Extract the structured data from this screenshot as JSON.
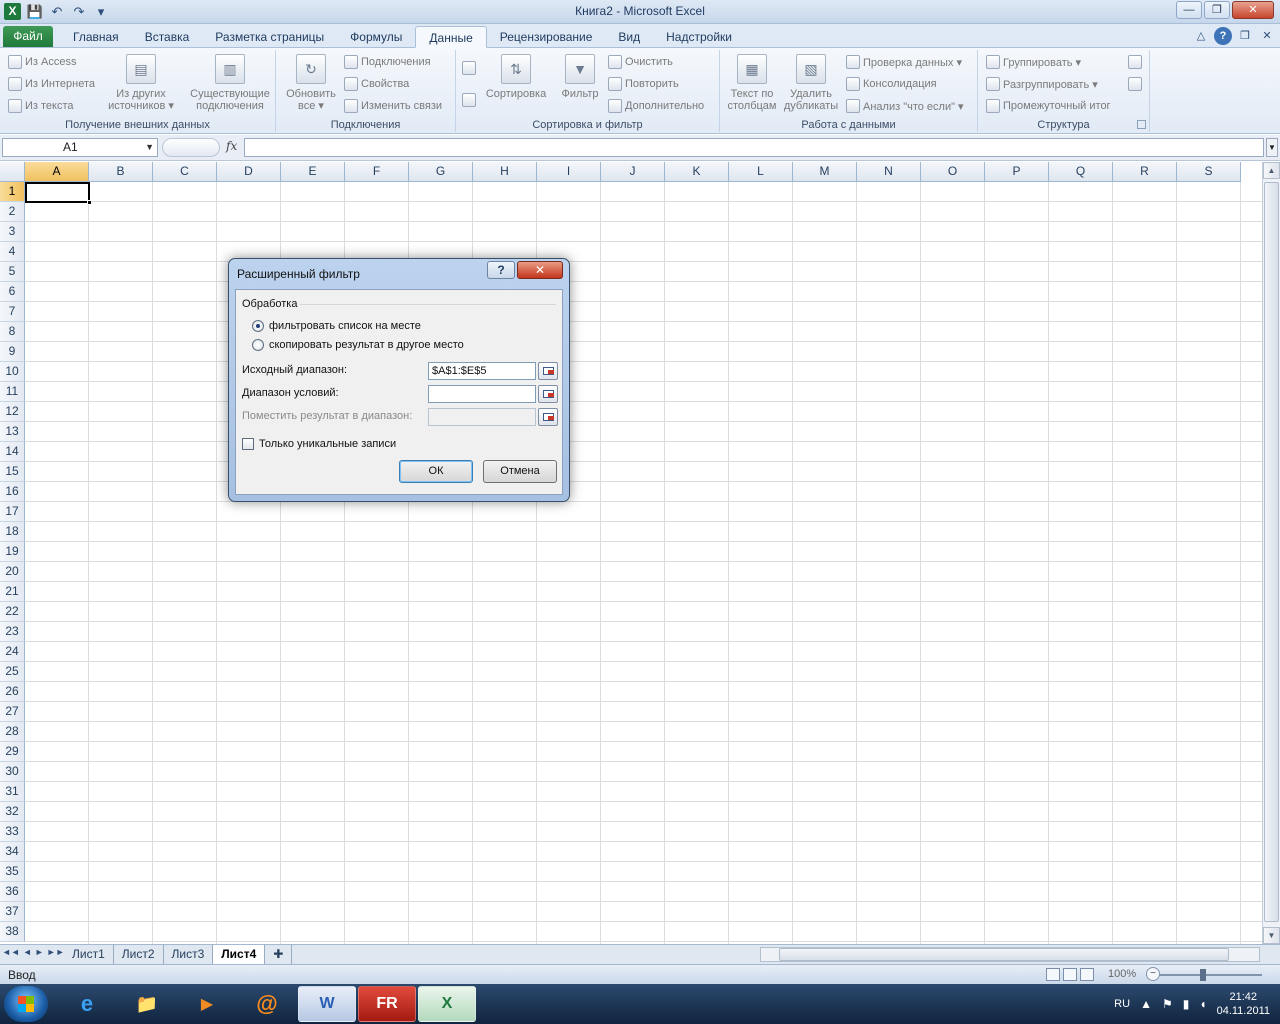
{
  "window": {
    "title": "Книга2  -  Microsoft Excel",
    "app_icon": "X"
  },
  "qat": {
    "save": "💾",
    "undo": "↶",
    "redo": "↷",
    "customize": "▾"
  },
  "win_controls": {
    "minimize": "—",
    "restore": "❐",
    "close": "✕"
  },
  "ribbon_tabs": {
    "file": "Файл",
    "items": [
      "Главная",
      "Вставка",
      "Разметка страницы",
      "Формулы",
      "Данные",
      "Рецензирование",
      "Вид",
      "Надстройки"
    ],
    "active_index": 4
  },
  "ribbon_right": {
    "minimize": "△",
    "help": "?",
    "restore": "❐",
    "close": "✕"
  },
  "ribbon": {
    "external": {
      "label": "Получение внешних данных",
      "from_access": "Из Access",
      "from_web": "Из Интернета",
      "from_text": "Из текста",
      "other_line1": "Из других",
      "other_line2": "источников ▾",
      "existing_line1": "Существующие",
      "existing_line2": "подключения"
    },
    "connections": {
      "label": "Подключения",
      "refresh_line1": "Обновить",
      "refresh_line2": "все ▾",
      "connections": "Подключения",
      "properties": "Свойства",
      "edit_links": "Изменить связи"
    },
    "sort_filter": {
      "label": "Сортировка и фильтр",
      "sort": "Сортировка",
      "filter": "Фильтр",
      "clear": "Очистить",
      "reapply": "Повторить",
      "advanced": "Дополнительно"
    },
    "data_tools": {
      "label": "Работа с данными",
      "text_to_columns_line1": "Текст по",
      "text_to_columns_line2": "столбцам",
      "remove_dup_line1": "Удалить",
      "remove_dup_line2": "дубликаты",
      "validation": "Проверка данных ▾",
      "consolidate": "Консолидация",
      "what_if": "Анализ \"что если\" ▾"
    },
    "outline": {
      "label": "Структура",
      "group": "Группировать ▾",
      "ungroup": "Разгруппировать ▾",
      "subtotal": "Промежуточный итог"
    }
  },
  "formula_bar": {
    "name_box": "A1",
    "fx": "fx",
    "formula": ""
  },
  "grid": {
    "columns": [
      "A",
      "B",
      "C",
      "D",
      "E",
      "F",
      "G",
      "H",
      "I",
      "J",
      "K",
      "L",
      "M",
      "N",
      "O",
      "P",
      "Q",
      "R",
      "S"
    ],
    "rows": [
      "1",
      "2",
      "3",
      "4",
      "5",
      "6",
      "7",
      "8",
      "9",
      "10",
      "11",
      "12",
      "13",
      "14",
      "15",
      "16",
      "17",
      "18",
      "19",
      "20",
      "21",
      "22",
      "23",
      "24",
      "25",
      "26",
      "27",
      "28",
      "29",
      "30",
      "31",
      "32",
      "33",
      "34",
      "35",
      "36",
      "37",
      "38"
    ],
    "selected_col": "A",
    "selected_row": "1"
  },
  "sheet_tabs": {
    "nav": [
      "◄◄",
      "◄",
      "►",
      "►►"
    ],
    "tabs": [
      "Лист1",
      "Лист2",
      "Лист3",
      "Лист4"
    ],
    "active_index": 3
  },
  "status": {
    "mode": "Ввод",
    "zoom": "100%",
    "zoom_minus": "−",
    "zoom_plus": "+"
  },
  "taskbar": {
    "items": [
      "e",
      "📁",
      "▶",
      "@",
      "W",
      "FR",
      "X"
    ],
    "lang": "RU",
    "time": "21:42",
    "date": "04.11.2011"
  },
  "dialog": {
    "title": "Расширенный фильтр",
    "help": "?",
    "close": "✕",
    "section": "Обработка",
    "radio_in_place": "фильтровать список на месте",
    "radio_copy": "скопировать результат в другое место",
    "list_range_label": "Исходный диапазон:",
    "list_range_value": "$A$1:$E$5",
    "criteria_label": "Диапазон условий:",
    "criteria_value": "",
    "copy_to_label": "Поместить результат в диапазон:",
    "copy_to_value": "",
    "unique_label": "Только уникальные записи",
    "ok": "ОК",
    "cancel": "Отмена"
  }
}
